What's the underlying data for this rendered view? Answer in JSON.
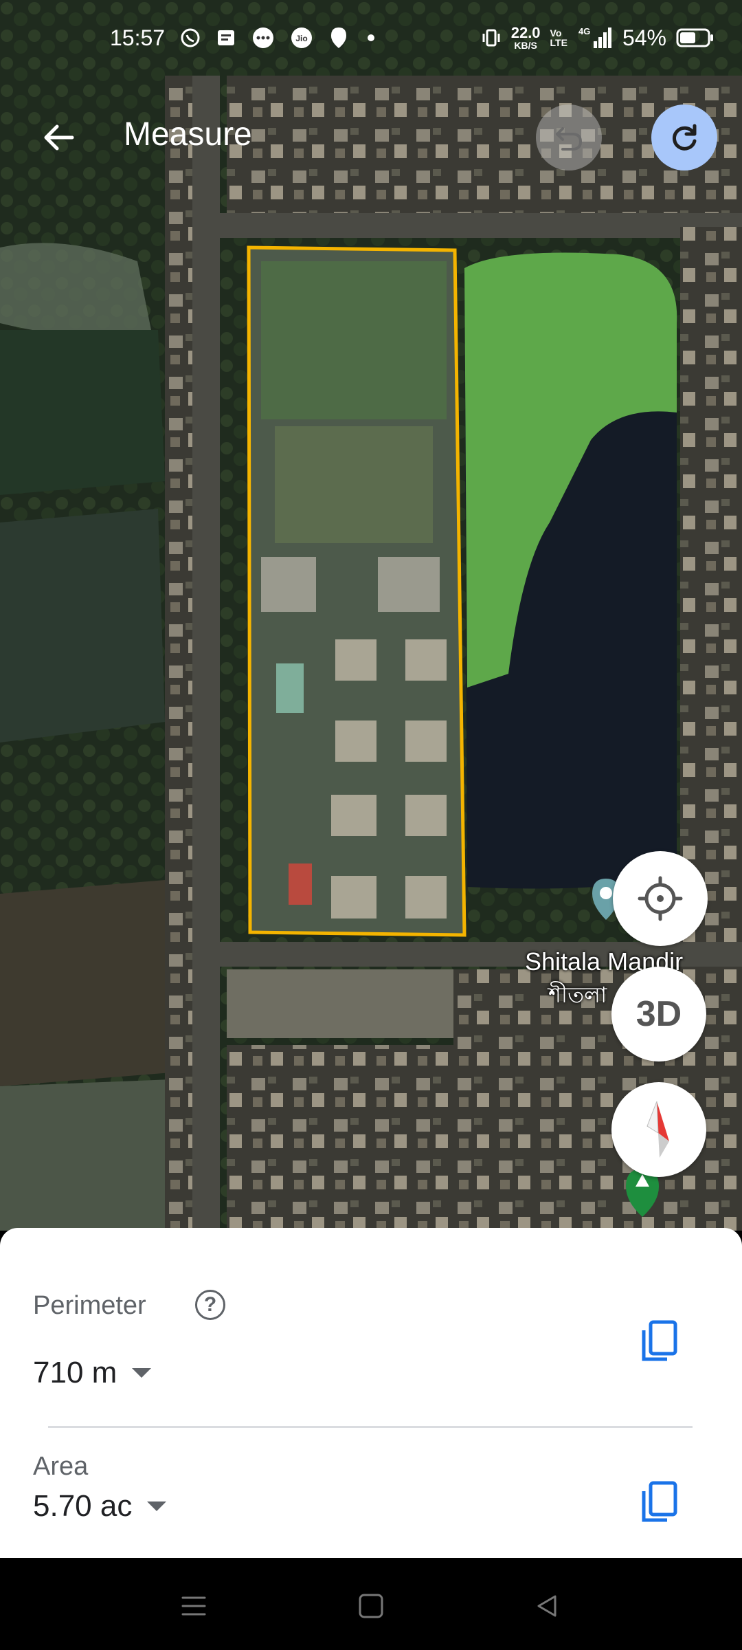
{
  "status_bar": {
    "time": "15:57",
    "net_speed_value": "22.0",
    "net_speed_unit": "KB/S",
    "volte_top": "Vo",
    "volte_bottom": "LTE",
    "network": "4G",
    "battery": "54%",
    "icons": [
      "whatsapp-icon",
      "messages-icon",
      "chat-icon",
      "jio-icon",
      "location-icon",
      "dot-icon",
      "vibrate-icon",
      "signal-icon",
      "battery-icon"
    ]
  },
  "header": {
    "title": "Measure",
    "back_icon": "arrow-back-icon",
    "undo_icon": "undo-icon",
    "redo_icon": "redo-icon"
  },
  "map": {
    "poi_name_en": "Shitala Mandir",
    "poi_name_local": "শীতলা",
    "controls": {
      "locate_icon": "my-location-icon",
      "three_d_label": "3D",
      "compass_icon": "compass-icon"
    },
    "polygon_color": "#f4b400"
  },
  "measurements": {
    "perimeter_label": "Perimeter",
    "perimeter_value": "710 m",
    "area_label": "Area",
    "area_value": "5.70 ac",
    "help_icon": "help-icon",
    "copy_icon": "copy-icon",
    "accent_color": "#1a73e8"
  },
  "nav_bar": {
    "icons": [
      "menu-icon",
      "home-icon",
      "back-icon"
    ]
  }
}
